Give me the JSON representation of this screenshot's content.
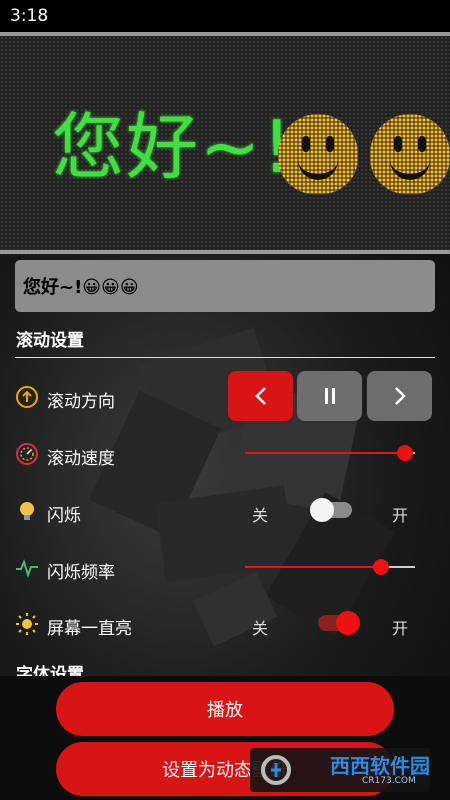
{
  "status_bar": {
    "time": "3:18"
  },
  "led_display": {
    "text": "您好~!",
    "emoji_count": 2,
    "text_color": "#3fe03f",
    "emoji_color": "#f5c23d"
  },
  "input": {
    "value": "您好~!😀😀😀"
  },
  "scroll_settings": {
    "title": "滚动设置",
    "direction": {
      "label": "滚动方向",
      "icon": "arrow-up-circle-icon",
      "buttons": [
        {
          "name": "left",
          "glyph": "‹",
          "active": true
        },
        {
          "name": "pause",
          "glyph": "❚❚",
          "active": false
        },
        {
          "name": "right",
          "glyph": "›",
          "active": false
        }
      ]
    },
    "speed": {
      "label": "滚动速度",
      "icon": "speedometer-icon",
      "value": 0.94
    },
    "blink": {
      "label": "闪烁",
      "icon": "lightbulb-icon",
      "off_label": "关",
      "on_label": "开",
      "on": false
    },
    "blink_rate": {
      "label": "闪烁频率",
      "icon": "wave-icon",
      "value": 0.8
    },
    "screen_on": {
      "label": "屏幕一直亮",
      "icon": "sun-icon",
      "off_label": "关",
      "on_label": "开",
      "on": true
    }
  },
  "font_settings": {
    "title": "字体设置"
  },
  "buttons": {
    "play": "播放",
    "set_wallpaper": "设置为动态壁纸"
  },
  "watermark": {
    "brand": "西西软件园",
    "site": "CR173.COM"
  },
  "colors": {
    "accent": "#d91414",
    "button_gray": "#6e6e6e"
  }
}
